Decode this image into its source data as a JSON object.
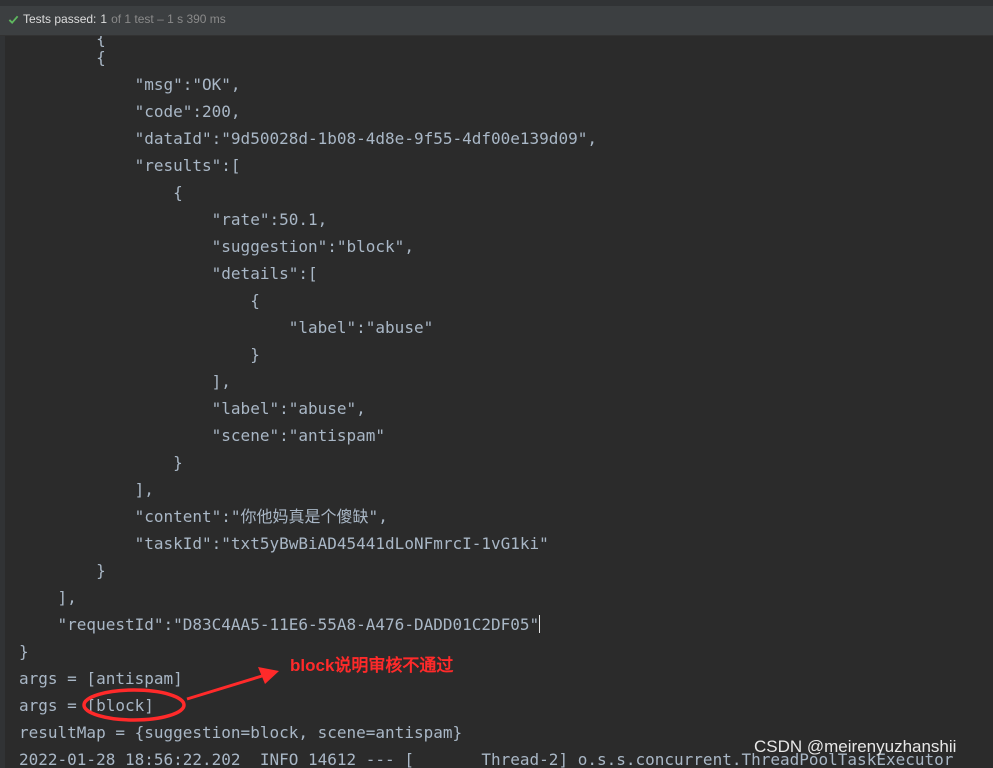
{
  "status": {
    "label": "Tests passed:",
    "count": "1",
    "detail": "of 1 test – 1 s 390 ms"
  },
  "console_lines": [
    "        {",
    "            \"msg\":\"OK\",",
    "            \"code\":200,",
    "            \"dataId\":\"9d50028d-1b08-4d8e-9f55-4df00e139d09\",",
    "            \"results\":[",
    "                {",
    "                    \"rate\":50.1,",
    "                    \"suggestion\":\"block\",",
    "                    \"details\":[",
    "                        {",
    "                            \"label\":\"abuse\"",
    "                        }",
    "                    ],",
    "                    \"label\":\"abuse\",",
    "                    \"scene\":\"antispam\"",
    "                }",
    "            ],",
    "            \"content\":\"你他妈真是个傻缺\",",
    "            \"taskId\":\"txt5yBwBiAD45441dLoNFmrcI-1vG1ki\"",
    "        }",
    "    ],",
    "    \"requestId\":\"D83C4AA5-11E6-55A8-A476-DADD01C2DF05\"",
    "}",
    "args = [antispam]",
    "args = [block]",
    "resultMap = {suggestion=block, scene=antispam}",
    "2022-01-28 18:56:22.202  INFO 14612 --- [       Thread-2] o.s.s.concurrent.ThreadPoolTaskExecutor"
  ],
  "annotation": "block说明审核不通过",
  "watermark": "CSDN @meirenyuzhanshii",
  "colors": {
    "background": "#2b2b2b",
    "text": "#a9b7c6",
    "annotation": "#ff2a2a",
    "pass_check": "#5fb85f"
  }
}
